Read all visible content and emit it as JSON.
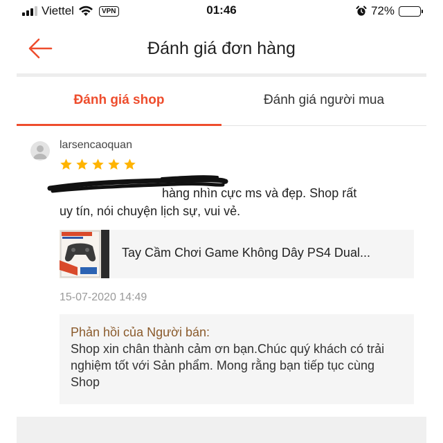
{
  "status_bar": {
    "carrier": "Viettel",
    "vpn": "VPN",
    "time": "01:46",
    "battery_percent_text": "72%",
    "battery_level": 0.72
  },
  "header": {
    "title": "Đánh giá đơn hàng",
    "back_icon": "arrow-left-icon"
  },
  "tabs": [
    {
      "label": "Đánh giá shop",
      "active": true
    },
    {
      "label": "Đánh giá người mua",
      "active": false
    }
  ],
  "review": {
    "username": "larsencaoquan",
    "rating": 5,
    "text_line1": "hàng nhìn cực ms và đẹp. Shop rất",
    "text_line2": "uy tín, nói chuyện lịch sự, vui vẻ.",
    "product": {
      "name": "Tay Cầm Chơi Game Không Dây PS4 Dual..."
    },
    "timestamp": "15-07-2020 14:49",
    "seller_reply": {
      "title": "Phản hồi của Người bán:",
      "text": "Shop xin chân thành cảm ơn bạn.Chúc quý khách có trải nghiệm tốt với Sản phẩm. Mong rằng bạn tiếp tục cùng Shop"
    }
  },
  "colors": {
    "accent": "#ee4d2d",
    "star": "#ffb400",
    "reply_title": "#8a5a2b"
  }
}
